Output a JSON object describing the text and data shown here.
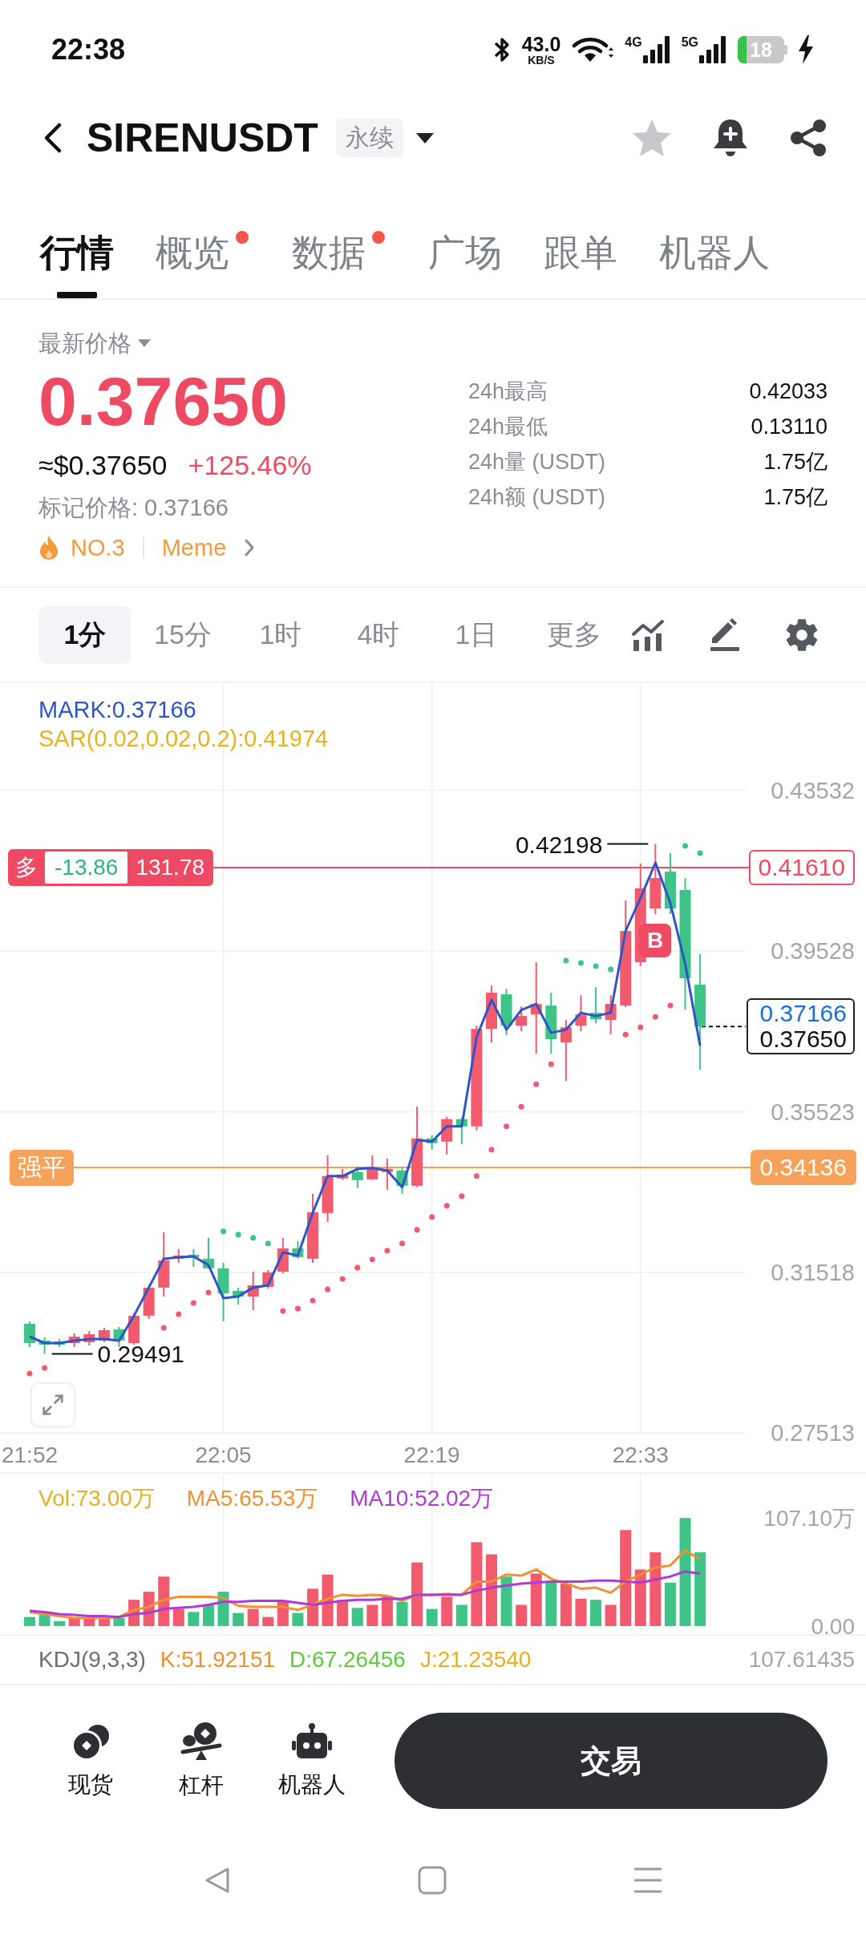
{
  "status_bar": {
    "time": "22:38",
    "speed": {
      "value": "43.0",
      "unit": "KB/S"
    },
    "networks": [
      {
        "label": "4G"
      },
      {
        "label": "5G"
      }
    ],
    "battery": {
      "percent": "18",
      "charging": true
    }
  },
  "header": {
    "symbol": "SIRENUSDT",
    "contract": "永续",
    "favorite": false
  },
  "tabs": [
    {
      "label": "行情",
      "selected": true,
      "dot": false
    },
    {
      "label": "概览",
      "selected": false,
      "dot": true
    },
    {
      "label": "数据",
      "selected": false,
      "dot": true
    },
    {
      "label": "广场",
      "selected": false,
      "dot": false
    },
    {
      "label": "跟单",
      "selected": false,
      "dot": false
    },
    {
      "label": "机器人",
      "selected": false,
      "dot": false
    }
  ],
  "price": {
    "label": "最新价格",
    "last": "0.37650",
    "usd": "≈$0.37650",
    "change": "+125.46%",
    "mark": "标记价格: 0.37166",
    "rank": "NO.3",
    "sector": "Meme",
    "stats": [
      {
        "label": "24h最高",
        "value": "0.42033"
      },
      {
        "label": "24h最低",
        "value": "0.13110"
      },
      {
        "label": "24h量 (USDT)",
        "value": "1.75亿"
      },
      {
        "label": "24h额 (USDT)",
        "value": "1.75亿"
      }
    ]
  },
  "timeframes": [
    {
      "label": "1分",
      "selected": true
    },
    {
      "label": "15分",
      "selected": false
    },
    {
      "label": "1时",
      "selected": false
    },
    {
      "label": "4时",
      "selected": false
    },
    {
      "label": "1日",
      "selected": false
    },
    {
      "label": "更多",
      "selected": false
    }
  ],
  "chart": {
    "indicator": {
      "text": "SAR(0.02,0.02,0.2):0.41974",
      "color": "#e6b31e"
    },
    "position": {
      "side": "多",
      "pnl": "-13.86",
      "size": "131.78"
    },
    "liquidation": {
      "label": "强平"
    },
    "buy_marker": "B",
    "mark_price": "0.37166",
    "chart_data": {
      "type": "candlestick",
      "categories": [
        "21:52",
        null,
        null,
        null,
        null,
        null,
        null,
        null,
        null,
        null,
        null,
        null,
        null,
        "22:05",
        null,
        null,
        null,
        null,
        null,
        null,
        null,
        null,
        null,
        null,
        null,
        null,
        null,
        "22:19",
        null,
        null,
        null,
        null,
        null,
        null,
        null,
        null,
        null,
        null,
        null,
        null,
        null,
        "22:33",
        null,
        null,
        null,
        null
      ],
      "ohlc": [
        [
          0.3024,
          0.303,
          0.2966,
          0.2976
        ],
        [
          0.2982,
          0.299,
          0.29491,
          0.2972
        ],
        [
          0.298,
          0.2986,
          0.2966,
          0.2972
        ],
        [
          0.2976,
          0.3,
          0.2966,
          0.2992
        ],
        [
          0.2978,
          0.3006,
          0.297,
          0.2998
        ],
        [
          0.2982,
          0.3014,
          0.2978,
          0.3008
        ],
        [
          0.301,
          0.3016,
          0.2966,
          0.2982
        ],
        [
          0.2976,
          0.305,
          0.2972,
          0.3044
        ],
        [
          0.3044,
          0.312,
          0.3036,
          0.3114
        ],
        [
          0.3114,
          0.3252,
          0.3092,
          0.3182
        ],
        [
          0.3186,
          0.321,
          0.3176,
          0.3194
        ],
        [
          0.3196,
          0.321,
          0.3166,
          0.319
        ],
        [
          0.3186,
          0.3238,
          0.3162,
          0.3162
        ],
        [
          0.3162,
          0.3176,
          0.303,
          0.31
        ],
        [
          0.3106,
          0.3114,
          0.3072,
          0.3092
        ],
        [
          0.3092,
          0.3154,
          0.3058,
          0.312
        ],
        [
          0.3116,
          0.3158,
          0.3112,
          0.3152
        ],
        [
          0.3154,
          0.3238,
          0.315,
          0.3212
        ],
        [
          0.3212,
          0.323,
          0.3186,
          0.319
        ],
        [
          0.3186,
          0.3348,
          0.3176,
          0.3302
        ],
        [
          0.33,
          0.3444,
          0.3278,
          0.3392
        ],
        [
          0.3386,
          0.341,
          0.3382,
          0.3396
        ],
        [
          0.3402,
          0.3416,
          0.3362,
          0.3382
        ],
        [
          0.3384,
          0.3444,
          0.3382,
          0.3412
        ],
        [
          0.3402,
          0.3436,
          0.3358,
          0.341
        ],
        [
          0.3406,
          0.3414,
          0.3348,
          0.3368
        ],
        [
          0.3368,
          0.3565,
          0.3364,
          0.3486
        ],
        [
          0.3486,
          0.3494,
          0.3458,
          0.3474
        ],
        [
          0.3478,
          0.354,
          0.3446,
          0.3534
        ],
        [
          0.3534,
          0.3538,
          0.3472,
          0.3516
        ],
        [
          0.3516,
          0.3767,
          0.3506,
          0.3759
        ],
        [
          0.3759,
          0.3867,
          0.3725,
          0.3849
        ],
        [
          0.3845,
          0.3859,
          0.3743,
          0.3767
        ],
        [
          0.3767,
          0.3815,
          0.3753,
          0.3791
        ],
        [
          0.3795,
          0.3925,
          0.3697,
          0.3821
        ],
        [
          0.3817,
          0.3849,
          0.3697,
          0.3733
        ],
        [
          0.3725,
          0.3781,
          0.3629,
          0.3763
        ],
        [
          0.3767,
          0.3843,
          0.3753,
          0.3795
        ],
        [
          0.3799,
          0.3863,
          0.3773,
          0.3783
        ],
        [
          0.3781,
          0.3843,
          0.3745,
          0.3821
        ],
        [
          0.3817,
          0.4079,
          0.3813,
          0.4003
        ],
        [
          0.3925,
          0.4171,
          0.3915,
          0.4109
        ],
        [
          0.4059,
          0.42198,
          0.4045,
          0.4135
        ],
        [
          0.4151,
          0.4197,
          0.4045,
          0.4059
        ],
        [
          0.4105,
          0.4135,
          0.3807,
          0.3885
        ],
        [
          0.3869,
          0.3945,
          0.3657,
          0.3765
        ]
      ],
      "ylim": [
        0.27461,
        0.46206
      ],
      "yticks": [
        {
          "value": 0.43532,
          "label": "0.43532"
        },
        {
          "value": 0.39528,
          "label": "0.39528"
        },
        {
          "value": 0.35523,
          "label": "0.35523"
        },
        {
          "value": 0.31518,
          "label": "0.31518"
        },
        {
          "value": 0.27513,
          "label": "0.27513"
        }
      ],
      "grid": true,
      "series": [
        {
          "name": "MARK:0.37166",
          "type": "line",
          "color": "#2d55c9",
          "values": [
            0.2992,
            0.2976,
            0.2976,
            0.2982,
            0.2986,
            0.2986,
            0.2982,
            0.3044,
            0.3114,
            0.3186,
            0.319,
            0.3192,
            0.317,
            0.3088,
            0.3092,
            0.3114,
            0.312,
            0.3202,
            0.3194,
            0.33,
            0.3392,
            0.3392,
            0.341,
            0.3412,
            0.3406,
            0.3364,
            0.3482,
            0.3478,
            0.3516,
            0.3516,
            0.3739,
            0.3831,
            0.3757,
            0.3806,
            0.3821,
            0.3749,
            0.3757,
            0.3799,
            0.3791,
            0.3799,
            0.4003,
            0.4085,
            0.4173,
            0.4073,
            0.3921,
            0.3717
          ]
        },
        {
          "type": "scatter",
          "color": "#f25a6d",
          "values": [
            0.29,
            0.2914,
            null,
            null,
            null,
            null,
            null,
            null,
            null,
            0.3014,
            0.3048,
            0.3076,
            0.3102,
            null,
            null,
            null,
            null,
            0.3056,
            0.3062,
            0.3082,
            0.311,
            0.3136,
            0.3164,
            0.3184,
            0.3206,
            0.3224,
            0.3258,
            0.329,
            0.3318,
            0.3342,
            0.3392,
            0.3458,
            0.3516,
            0.3565,
            0.3621,
            0.3671,
            null,
            null,
            null,
            null,
            0.3745,
            0.3763,
            0.3789,
            0.3817,
            null,
            null
          ]
        },
        {
          "type": "scatter",
          "color": "#3fc488",
          "values": [
            null,
            null,
            null,
            null,
            null,
            null,
            null,
            null,
            null,
            null,
            null,
            null,
            null,
            0.3254,
            0.3246,
            0.3238,
            0.3224,
            null,
            null,
            null,
            null,
            null,
            null,
            null,
            null,
            null,
            null,
            null,
            null,
            null,
            null,
            null,
            null,
            null,
            null,
            null,
            0.3929,
            0.3923,
            0.3915,
            0.3907,
            null,
            null,
            null,
            null,
            0.4215,
            0.4197
          ]
        }
      ],
      "ref_lines": [
        {
          "axis": "y",
          "value": 0.4161,
          "label": "0.41610",
          "color": "#ef4a63"
        },
        {
          "axis": "y",
          "value": 0.34136,
          "label": "0.34136",
          "color": "#f0a050"
        },
        {
          "axis": "y",
          "value": 0.3765,
          "label": "0.37650",
          "color": "#111111"
        }
      ],
      "annotations": [
        "0.42198",
        "0.29491"
      ]
    }
  },
  "volume": {
    "label": {
      "text": "Vol:73.00万",
      "color": "#e8b020"
    },
    "chart_data": {
      "type": "bar",
      "categories": [
        null,
        null,
        null,
        null,
        null,
        null,
        null,
        null,
        null,
        null,
        null,
        null,
        null,
        null,
        null,
        null,
        null,
        null,
        null,
        null,
        null,
        null,
        null,
        null,
        null,
        null,
        null,
        null,
        null,
        null,
        null,
        null,
        null,
        null,
        null,
        null,
        null,
        null,
        null,
        null,
        null,
        null,
        null,
        null,
        null,
        null
      ],
      "ylim": [
        0,
        107.1
      ],
      "yticks": [
        {
          "value": 107.1,
          "label": "107.10万"
        },
        {
          "value": 0,
          "label": "0.00"
        }
      ],
      "grid": true,
      "series": [
        {
          "type": "bar",
          "color": "#f25a6d",
          "values": [
            null,
            null,
            null,
            8,
            8,
            8,
            null,
            26,
            34,
            49,
            17,
            null,
            null,
            null,
            null,
            17,
            9,
            25,
            null,
            37,
            51,
            26,
            null,
            21,
            30,
            null,
            63,
            null,
            29,
            null,
            83,
            71,
            null,
            21,
            52,
            null,
            42,
            27,
            null,
            21,
            95,
            56,
            73,
            null,
            null,
            null
          ]
        },
        {
          "type": "bar",
          "color": "#3fc488",
          "values": [
            9,
            11,
            5,
            null,
            null,
            null,
            8,
            null,
            null,
            null,
            null,
            14,
            21,
            34,
            13,
            null,
            null,
            null,
            13,
            null,
            null,
            null,
            18,
            null,
            null,
            24,
            null,
            17,
            null,
            21,
            null,
            null,
            49,
            null,
            null,
            43,
            null,
            null,
            26,
            null,
            null,
            null,
            null,
            43,
            107,
            73
          ]
        },
        {
          "name": "MA5:65.53万",
          "type": "line",
          "color": "#ee9133",
          "values": [
            14,
            12,
            10,
            8,
            8,
            8,
            9,
            16,
            19,
            26,
            29,
            29,
            29,
            28,
            20,
            19,
            19,
            19,
            16,
            21,
            27,
            31,
            30,
            31,
            30,
            25,
            31,
            31,
            32,
            31,
            44,
            44,
            51,
            50,
            56,
            47,
            42,
            37,
            38,
            33,
            44,
            51,
            58,
            60,
            75,
            66
          ]
        },
        {
          "name": "MA10:52.02万",
          "type": "line",
          "color": "#b03ad4",
          "values": [
            15,
            14,
            12,
            11,
            10,
            10,
            9,
            12,
            13,
            17,
            18,
            19,
            21,
            24,
            24,
            25,
            25,
            25,
            23,
            21,
            23,
            25,
            26,
            26,
            27,
            27,
            31,
            31,
            31,
            31,
            35,
            38,
            40,
            42,
            43,
            44,
            44,
            44,
            45,
            45,
            44,
            43,
            46,
            49,
            54,
            52
          ]
        }
      ]
    }
  },
  "kdj": {
    "legend": [
      {
        "text": "KDJ(9,3,3)",
        "color": "#6b6e75"
      },
      {
        "text": "K:51.92151",
        "color": "#ee9133"
      },
      {
        "text": "D:67.26456",
        "color": "#5ccc3a"
      },
      {
        "text": "J:21.23540",
        "color": "#e8b020"
      }
    ],
    "axis": "107.61435"
  },
  "bottom_bar": {
    "shortcuts": [
      {
        "kind": "spot",
        "label": "现货"
      },
      {
        "kind": "margin",
        "label": "杠杆"
      },
      {
        "kind": "bot",
        "label": "机器人"
      }
    ],
    "trade": "交易"
  }
}
